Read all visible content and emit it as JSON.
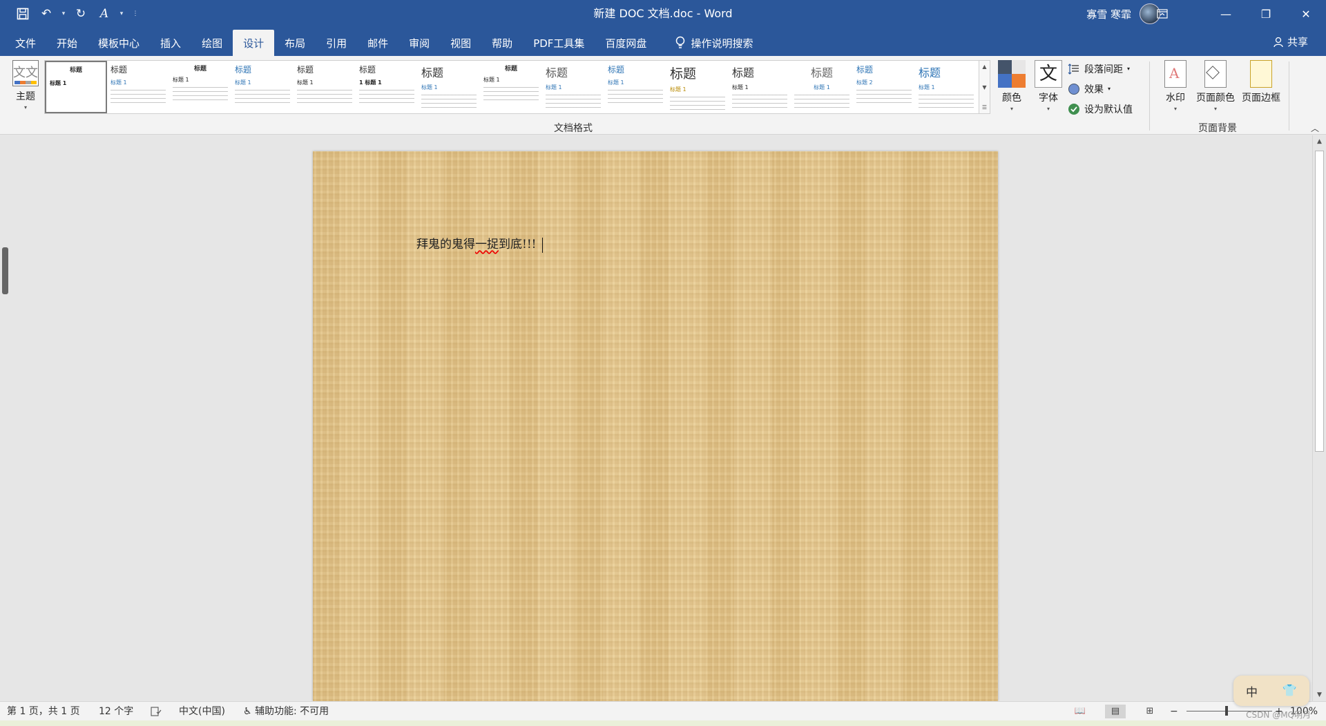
{
  "titlebar": {
    "title": "新建 DOC 文档.doc  -  Word",
    "user_name": "寡雪 寒霏"
  },
  "tabs": [
    {
      "label": "文件",
      "active": false
    },
    {
      "label": "开始",
      "active": false
    },
    {
      "label": "模板中心",
      "active": false
    },
    {
      "label": "插入",
      "active": false
    },
    {
      "label": "绘图",
      "active": false
    },
    {
      "label": "设计",
      "active": true
    },
    {
      "label": "布局",
      "active": false
    },
    {
      "label": "引用",
      "active": false
    },
    {
      "label": "邮件",
      "active": false
    },
    {
      "label": "审阅",
      "active": false
    },
    {
      "label": "视图",
      "active": false
    },
    {
      "label": "帮助",
      "active": false
    },
    {
      "label": "PDF工具集",
      "active": false
    },
    {
      "label": "百度网盘",
      "active": false
    }
  ],
  "search_label": "操作说明搜索",
  "share_label": "共享",
  "ribbon": {
    "themes_label": "主题",
    "theme_icon_glyph": "文文",
    "gallery_label": "文档格式",
    "colors_label": "颜色",
    "fonts_label": "字体",
    "fonts_glyph": "文",
    "paragraph_spacing_label": "段落间距",
    "effects_label": "效果",
    "set_default_label": "设为默认值",
    "watermark_label": "水印",
    "page_color_label": "页面颜色",
    "page_borders_label": "页面边框",
    "page_background_label": "页面背景",
    "style_items": [
      {
        "heading": "标题",
        "sub": "标题 1"
      },
      {
        "heading": "标题",
        "sub": "标题 1"
      },
      {
        "heading": "标题",
        "sub": "标题 1"
      },
      {
        "heading": "标题",
        "sub": "标题 1"
      },
      {
        "heading": "标题",
        "sub": "标题 1"
      },
      {
        "heading": "标题",
        "sub": "1 标题 1"
      },
      {
        "heading": "标题",
        "sub": "标题 1"
      },
      {
        "heading": "标题",
        "sub": "标题 1"
      },
      {
        "heading": "标题",
        "sub": "标题 1"
      },
      {
        "heading": "标题",
        "sub": "标题 1"
      },
      {
        "heading": "标题",
        "sub": "标题 1"
      },
      {
        "heading": "标题",
        "sub": "标题 1"
      },
      {
        "heading": "标题",
        "sub": "标题 1"
      },
      {
        "heading": "标题",
        "sub": "标题 2"
      },
      {
        "heading": "标题",
        "sub": "标题 1"
      }
    ]
  },
  "document": {
    "text_before": "拜鬼的鬼得",
    "text_squiggle": "一捉",
    "text_after": "到底!!!"
  },
  "statusbar": {
    "page": "第 1 页，共 1 页",
    "words": "12 个字",
    "language": "中文(中国)",
    "accessibility": "辅助功能: 不可用",
    "zoom": "100%"
  },
  "ime": {
    "mode": "中"
  },
  "watermark_text": "CSDN @MQ明月"
}
